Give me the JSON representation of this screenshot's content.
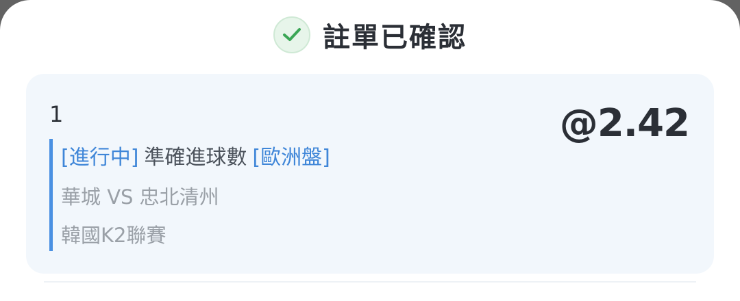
{
  "header": {
    "title": "註單已確認",
    "icon": "check-circle-icon",
    "icon_color": "#3aa655"
  },
  "bet": {
    "index": "1",
    "odds": "@2.42",
    "status": "[進行中]",
    "market_type": "準確進球數",
    "odds_format": "[歐洲盤]",
    "match": "華城 VS 忠北清州",
    "league": "韓國K2聯賽"
  },
  "colors": {
    "accent": "#3f86d8",
    "card_bg": "#f2f7fc",
    "text_primary": "#2b2f36",
    "text_secondary": "#9aa0a7"
  }
}
